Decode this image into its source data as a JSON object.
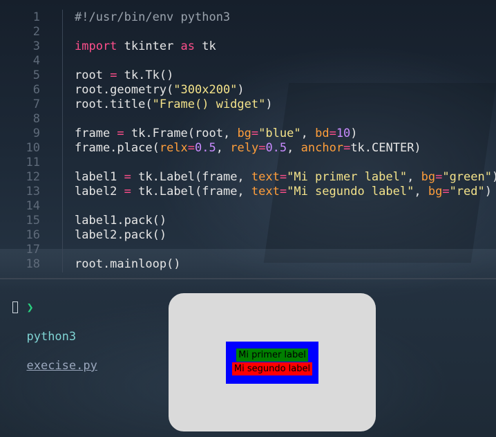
{
  "editor": {
    "lines": [
      {
        "num": "1",
        "tokens": [
          {
            "t": "#!/usr/bin/env python3",
            "c": "comment"
          }
        ]
      },
      {
        "num": "2",
        "tokens": []
      },
      {
        "num": "3",
        "tokens": [
          {
            "t": "import",
            "c": "kw"
          },
          {
            "t": " tkinter ",
            "c": ""
          },
          {
            "t": "as",
            "c": "kw"
          },
          {
            "t": " tk",
            "c": ""
          }
        ]
      },
      {
        "num": "4",
        "tokens": []
      },
      {
        "num": "5",
        "tokens": [
          {
            "t": "root ",
            "c": ""
          },
          {
            "t": "=",
            "c": "op"
          },
          {
            "t": " tk.Tk()",
            "c": ""
          }
        ]
      },
      {
        "num": "6",
        "tokens": [
          {
            "t": "root.geometry(",
            "c": ""
          },
          {
            "t": "\"300x200\"",
            "c": "str"
          },
          {
            "t": ")",
            "c": ""
          }
        ]
      },
      {
        "num": "7",
        "tokens": [
          {
            "t": "root.title(",
            "c": ""
          },
          {
            "t": "\"Frame() widget\"",
            "c": "str"
          },
          {
            "t": ")",
            "c": ""
          }
        ]
      },
      {
        "num": "8",
        "tokens": []
      },
      {
        "num": "9",
        "tokens": [
          {
            "t": "frame ",
            "c": ""
          },
          {
            "t": "=",
            "c": "op"
          },
          {
            "t": " tk.Frame(root, ",
            "c": ""
          },
          {
            "t": "bg",
            "c": "kwarg"
          },
          {
            "t": "=",
            "c": "op"
          },
          {
            "t": "\"blue\"",
            "c": "str"
          },
          {
            "t": ", ",
            "c": ""
          },
          {
            "t": "bd",
            "c": "kwarg"
          },
          {
            "t": "=",
            "c": "op"
          },
          {
            "t": "10",
            "c": "num"
          },
          {
            "t": ")",
            "c": ""
          }
        ]
      },
      {
        "num": "10",
        "tokens": [
          {
            "t": "frame.place(",
            "c": ""
          },
          {
            "t": "relx",
            "c": "kwarg"
          },
          {
            "t": "=",
            "c": "op"
          },
          {
            "t": "0.5",
            "c": "num"
          },
          {
            "t": ", ",
            "c": ""
          },
          {
            "t": "rely",
            "c": "kwarg"
          },
          {
            "t": "=",
            "c": "op"
          },
          {
            "t": "0.5",
            "c": "num"
          },
          {
            "t": ", ",
            "c": ""
          },
          {
            "t": "anchor",
            "c": "kwarg"
          },
          {
            "t": "=",
            "c": "op"
          },
          {
            "t": "tk.CENTER)",
            "c": ""
          }
        ]
      },
      {
        "num": "11",
        "tokens": []
      },
      {
        "num": "12",
        "tokens": [
          {
            "t": "label1 ",
            "c": ""
          },
          {
            "t": "=",
            "c": "op"
          },
          {
            "t": " tk.Label(frame, ",
            "c": ""
          },
          {
            "t": "text",
            "c": "kwarg"
          },
          {
            "t": "=",
            "c": "op"
          },
          {
            "t": "\"Mi primer label\"",
            "c": "str"
          },
          {
            "t": ", ",
            "c": ""
          },
          {
            "t": "bg",
            "c": "kwarg"
          },
          {
            "t": "=",
            "c": "op"
          },
          {
            "t": "\"green\"",
            "c": "str"
          },
          {
            "t": ")",
            "c": ""
          }
        ]
      },
      {
        "num": "13",
        "tokens": [
          {
            "t": "label2 ",
            "c": ""
          },
          {
            "t": "=",
            "c": "op"
          },
          {
            "t": " tk.Label(frame, ",
            "c": ""
          },
          {
            "t": "text",
            "c": "kwarg"
          },
          {
            "t": "=",
            "c": "op"
          },
          {
            "t": "\"Mi segundo label\"",
            "c": "str"
          },
          {
            "t": ", ",
            "c": ""
          },
          {
            "t": "bg",
            "c": "kwarg"
          },
          {
            "t": "=",
            "c": "op"
          },
          {
            "t": "\"red\"",
            "c": "str"
          },
          {
            "t": ")",
            "c": ""
          }
        ]
      },
      {
        "num": "14",
        "tokens": []
      },
      {
        "num": "15",
        "tokens": [
          {
            "t": "label1.pack()",
            "c": ""
          }
        ]
      },
      {
        "num": "16",
        "tokens": [
          {
            "t": "label2.pack()",
            "c": ""
          }
        ]
      },
      {
        "num": "17",
        "tokens": []
      },
      {
        "num": "18",
        "tokens": [
          {
            "t": "root.mainloop()",
            "c": ""
          }
        ]
      }
    ]
  },
  "terminal": {
    "prompt_symbol": "❯",
    "command": "python3",
    "file": "execise.py"
  },
  "tk_window": {
    "label1": {
      "text": "Mi primer label",
      "bg": "#008000"
    },
    "label2": {
      "text": "Mi segundo label",
      "bg": "#ff0000"
    },
    "frame_bg": "#0000ff",
    "window_bg": "#dadada"
  },
  "colors": {
    "keyword": "#ff4f8b",
    "string": "#f3e28a",
    "number": "#c98bff",
    "kwarg": "#ff9e3b",
    "comment": "#9aa3ad",
    "prompt": "#29d17f"
  }
}
